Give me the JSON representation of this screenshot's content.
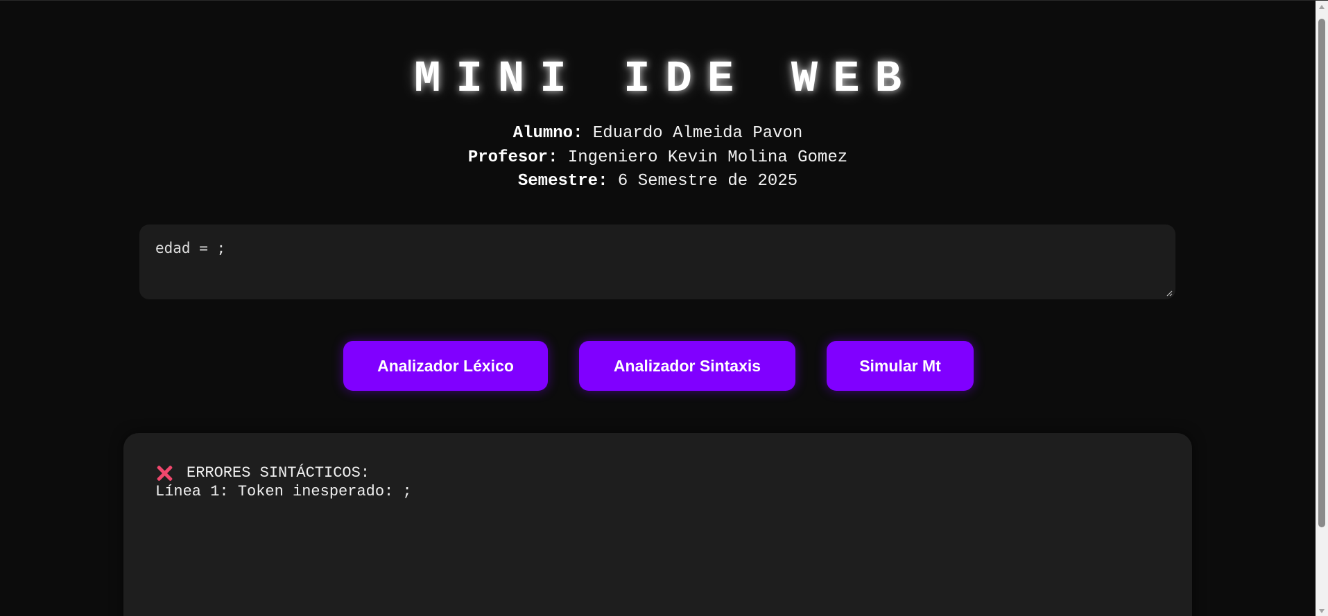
{
  "header": {
    "title": "MINI IDE WEB",
    "alumno_label": "Alumno:",
    "alumno_value": " Eduardo Almeida Pavon",
    "profesor_label": "Profesor:",
    "profesor_value": " Ingeniero Kevin Molina Gomez",
    "semestre_label": "Semestre:",
    "semestre_value": " 6 Semestre de 2025"
  },
  "editor": {
    "value": "edad = ;"
  },
  "buttons": {
    "lexico": "Analizador Léxico",
    "sintaxis": "Analizador Sintaxis",
    "simular": "Simular Mt"
  },
  "output": {
    "icon": "x-icon",
    "heading": "ERRORES SINTÁCTICOS:",
    "line1": "Línea 1: Token inesperado: ;"
  },
  "colors": {
    "background": "#0c0c0c",
    "accent": "#8000ff",
    "panel": "#1e1e1e",
    "error": "#f0476d"
  }
}
